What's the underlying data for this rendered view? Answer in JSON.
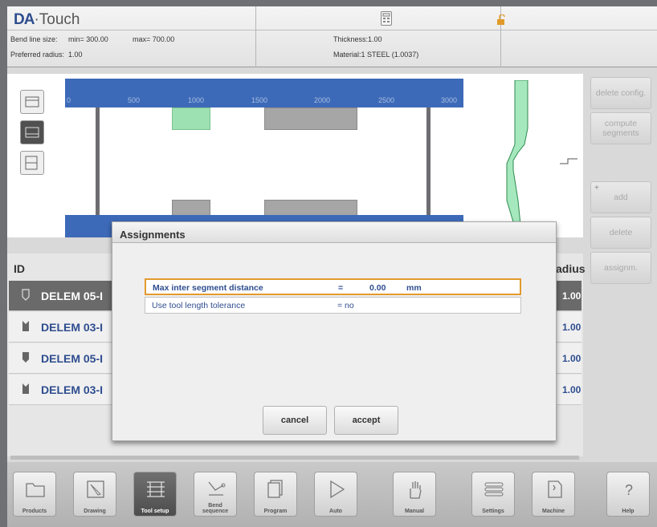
{
  "header": {
    "logo_bold": "DA",
    "logo_dot": "·",
    "logo_light": "Touch",
    "bend_line_size_label": "Bend line size:",
    "min": "min= 300.00",
    "max": "max= 700.00",
    "preferred_radius_label": "Preferred radius:",
    "preferred_radius": "1.00",
    "thickness": "Thickness:1.00",
    "material": "Material:1 STEEL (1.0037)"
  },
  "ruler": {
    "ticks": [
      "0",
      "500",
      "1000",
      "1500",
      "2000",
      "2500",
      "3000"
    ]
  },
  "side_buttons": {
    "delete_config": "delete config.",
    "compute_segments": "compute segments",
    "add_plus": "+",
    "add": "add",
    "delete": "delete",
    "assignm": "assignm."
  },
  "table": {
    "col_id": "ID",
    "col_radius": "adius",
    "rows": [
      {
        "name": "DELEM 05-I",
        "radius": "1.00"
      },
      {
        "name": "DELEM 03-I",
        "radius": "1.00"
      },
      {
        "name": "DELEM 05-I",
        "radius": "1.00"
      },
      {
        "name": "DELEM 03-I",
        "radius": "1.00"
      }
    ]
  },
  "dialog": {
    "title": "Assignments",
    "fields": [
      {
        "label": "Max inter segment distance",
        "eq": "=",
        "value": "0.00",
        "unit": "mm"
      },
      {
        "label": "Use tool length tolerance",
        "eq": "= no",
        "value": "",
        "unit": ""
      }
    ],
    "cancel": "cancel",
    "accept": "accept"
  },
  "nav": {
    "products": "Products",
    "drawing": "Drawing",
    "tool_setup": "Tool setup",
    "bend_sequence_1": "Bend",
    "bend_sequence_2": "sequence",
    "program": "Program",
    "auto": "Auto",
    "manual": "Manual",
    "settings": "Settings",
    "machine": "Machine",
    "help": "Help"
  },
  "colors": {
    "brand_blue": "#2e4d8f",
    "tool_blue": "#3d6ab8",
    "tool_green": "#9de0b2",
    "active_outline": "#e39a2d"
  },
  "icons": [
    "calculator-icon",
    "unlock-icon",
    "front-view-icon",
    "side-view-icon",
    "3d-view-icon",
    "punch-icon",
    "die-icon",
    "products-icon",
    "drawing-icon",
    "tool-setup-icon",
    "bend-sequence-icon",
    "program-icon",
    "auto-icon",
    "manual-icon",
    "settings-icon",
    "machine-icon",
    "help-icon"
  ]
}
